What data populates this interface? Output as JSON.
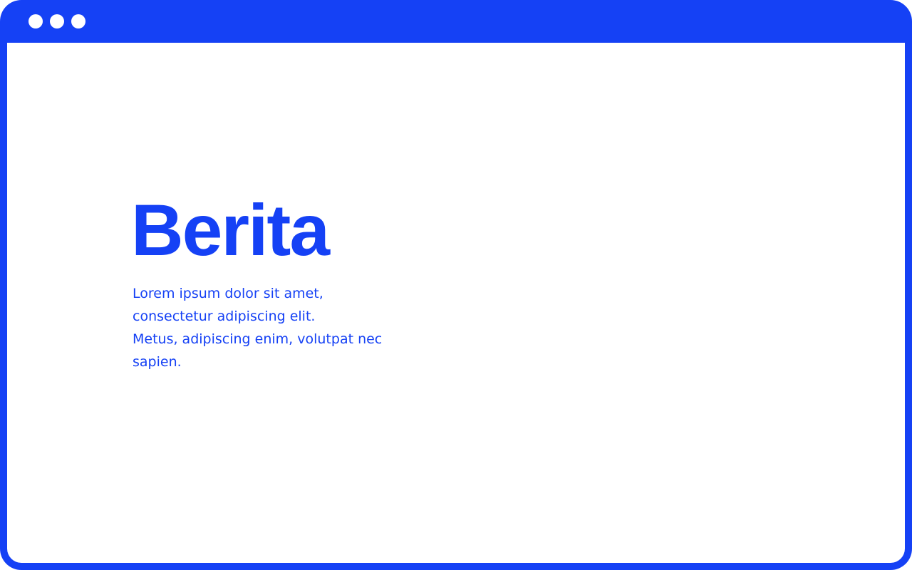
{
  "window": {
    "controls": [
      "window-dot",
      "window-dot",
      "window-dot"
    ],
    "accent_color": "#1541f5",
    "background_color": "#ffffff"
  },
  "main": {
    "title": "Berita",
    "body_lines": [
      "Lorem ipsum dolor sit amet,",
      "consectetur adipiscing elit.",
      "Metus, adipiscing enim, volutpat nec",
      "sapien."
    ]
  }
}
